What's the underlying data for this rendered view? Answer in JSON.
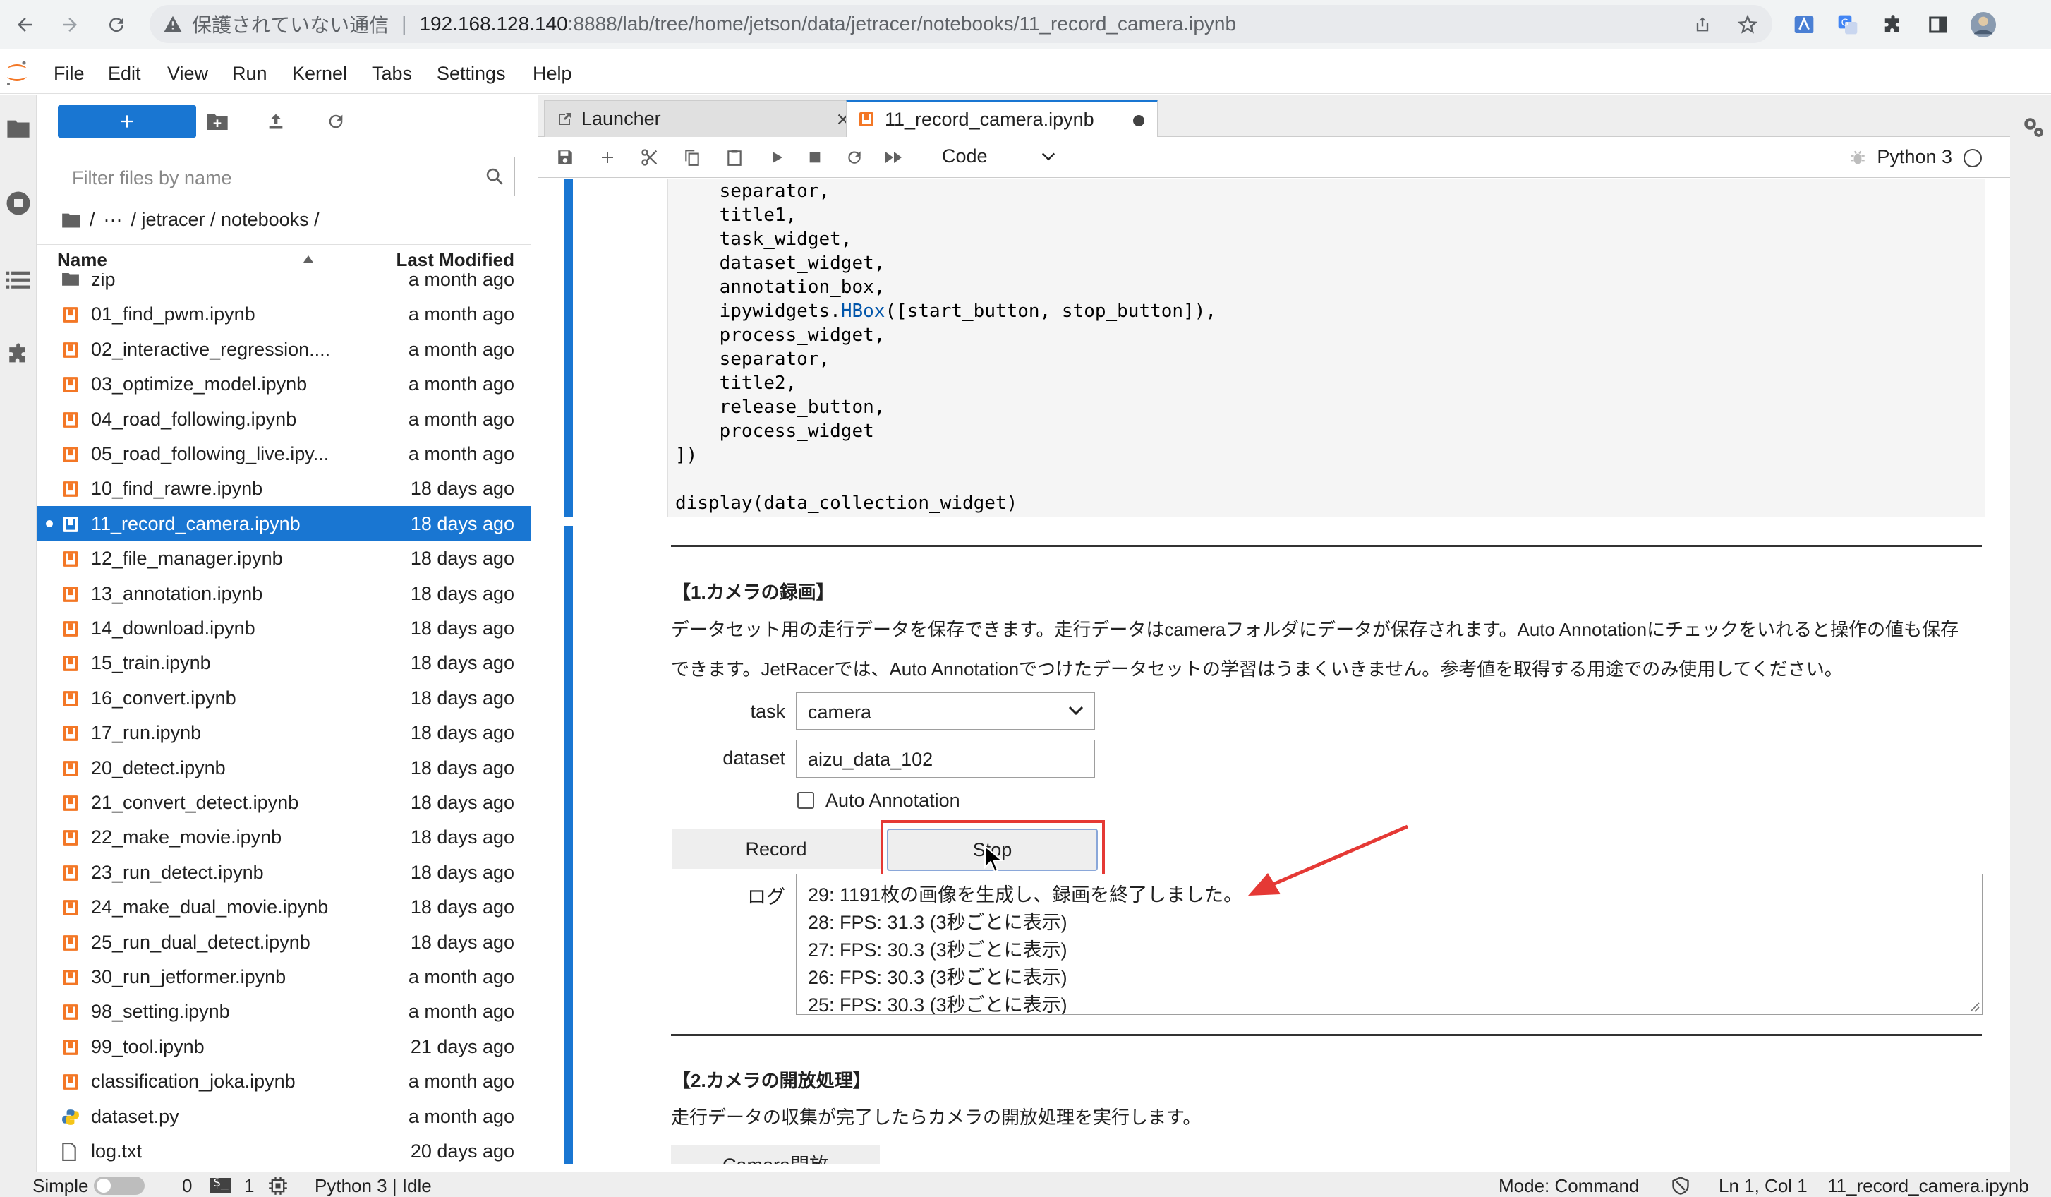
{
  "browser": {
    "insecure_label": "保護されていない通信",
    "url_host": "192.168.128.140",
    "url_path": ":8888/lab/tree/home/jetson/data/jetracer/notebooks/11_record_camera.ipynb"
  },
  "menu": [
    "File",
    "Edit",
    "View",
    "Run",
    "Kernel",
    "Tabs",
    "Settings",
    "Help"
  ],
  "filebrowser": {
    "filter_placeholder": "Filter files by name",
    "crumbs": [
      "/",
      "···",
      "/ jetracer / notebooks /"
    ],
    "col_name": "Name",
    "col_modified": "Last Modified",
    "files": [
      {
        "name": "zip",
        "date": "a month ago",
        "type": "folder"
      },
      {
        "name": "01_find_pwm.ipynb",
        "date": "a month ago",
        "type": "notebook"
      },
      {
        "name": "02_interactive_regression....",
        "date": "a month ago",
        "type": "notebook"
      },
      {
        "name": "03_optimize_model.ipynb",
        "date": "a month ago",
        "type": "notebook"
      },
      {
        "name": "04_road_following.ipynb",
        "date": "a month ago",
        "type": "notebook"
      },
      {
        "name": "05_road_following_live.ipy...",
        "date": "a month ago",
        "type": "notebook"
      },
      {
        "name": "10_find_rawre.ipynb",
        "date": "18 days ago",
        "type": "notebook"
      },
      {
        "name": "11_record_camera.ipynb",
        "date": "18 days ago",
        "type": "notebook",
        "selected": true
      },
      {
        "name": "12_file_manager.ipynb",
        "date": "18 days ago",
        "type": "notebook"
      },
      {
        "name": "13_annotation.ipynb",
        "date": "18 days ago",
        "type": "notebook"
      },
      {
        "name": "14_download.ipynb",
        "date": "18 days ago",
        "type": "notebook"
      },
      {
        "name": "15_train.ipynb",
        "date": "18 days ago",
        "type": "notebook"
      },
      {
        "name": "16_convert.ipynb",
        "date": "18 days ago",
        "type": "notebook"
      },
      {
        "name": "17_run.ipynb",
        "date": "18 days ago",
        "type": "notebook"
      },
      {
        "name": "20_detect.ipynb",
        "date": "18 days ago",
        "type": "notebook"
      },
      {
        "name": "21_convert_detect.ipynb",
        "date": "18 days ago",
        "type": "notebook"
      },
      {
        "name": "22_make_movie.ipynb",
        "date": "18 days ago",
        "type": "notebook"
      },
      {
        "name": "23_run_detect.ipynb",
        "date": "18 days ago",
        "type": "notebook"
      },
      {
        "name": "24_make_dual_movie.ipynb",
        "date": "18 days ago",
        "type": "notebook"
      },
      {
        "name": "25_run_dual_detect.ipynb",
        "date": "18 days ago",
        "type": "notebook"
      },
      {
        "name": "30_run_jetformer.ipynb",
        "date": "a month ago",
        "type": "notebook"
      },
      {
        "name": "98_setting.ipynb",
        "date": "a month ago",
        "type": "notebook"
      },
      {
        "name": "99_tool.ipynb",
        "date": "21 days ago",
        "type": "notebook"
      },
      {
        "name": "classification_joka.ipynb",
        "date": "a month ago",
        "type": "notebook"
      },
      {
        "name": "dataset.py",
        "date": "a month ago",
        "type": "python"
      },
      {
        "name": "log.txt",
        "date": "20 days ago",
        "type": "text"
      }
    ]
  },
  "tabs": [
    {
      "label": "Launcher",
      "active": false
    },
    {
      "label": "11_record_camera.ipynb",
      "active": true
    }
  ],
  "toolbar": {
    "cell_type": "Code",
    "kernel": "Python 3"
  },
  "code_lines": [
    "    separator,",
    "    title1,",
    "    task_widget,",
    "    dataset_widget,",
    "    annotation_box,",
    "    ipywidgets.HBox([start_button, stop_button]),",
    "    process_widget,",
    "    separator,",
    "    title2,",
    "    release_button,",
    "    process_widget",
    "])",
    "",
    "display(data_collection_widget)"
  ],
  "section1": {
    "heading": "【1.カメラの録画】",
    "para1": "データセット用の走行データを保存できます。走行データはcameraフォルダにデータが保存されます。Auto Annotationにチェックをいれると操作の値も保存",
    "para2": "できます。JetRacerでは、Auto Annotationでつけたデータセットの学習はうまくいきません。参考値を取得する用途でのみ使用してください。",
    "task_label": "task",
    "task_value": "camera",
    "dataset_label": "dataset",
    "dataset_value": "aizu_data_102",
    "auto_annotation": "Auto Annotation",
    "record_label": "Record",
    "stop_label": "Stop",
    "log_label": "ログ",
    "log_lines": [
      "29: 1191枚の画像を生成し、録画を終了しました。",
      "28: FPS: 31.3 (3秒ごとに表示)",
      "27: FPS: 30.3 (3秒ごとに表示)",
      "26: FPS: 30.3 (3秒ごとに表示)",
      "25: FPS: 30.3 (3秒ごとに表示)"
    ]
  },
  "section2": {
    "heading": "【2.カメラの開放処理】",
    "para": "走行データの収集が完了したらカメラの開放処理を実行します。",
    "button": "Camera開放"
  },
  "status": {
    "mode_simple": "Simple",
    "count_a": "0",
    "count_b": "1",
    "kernel_state": "Python 3 | Idle",
    "mode": "Mode: Command",
    "position": "Ln 1, Col 1",
    "filename": "11_record_camera.ipynb"
  },
  "colors": {
    "accent": "#1976d2",
    "highlight": "#e53935"
  }
}
